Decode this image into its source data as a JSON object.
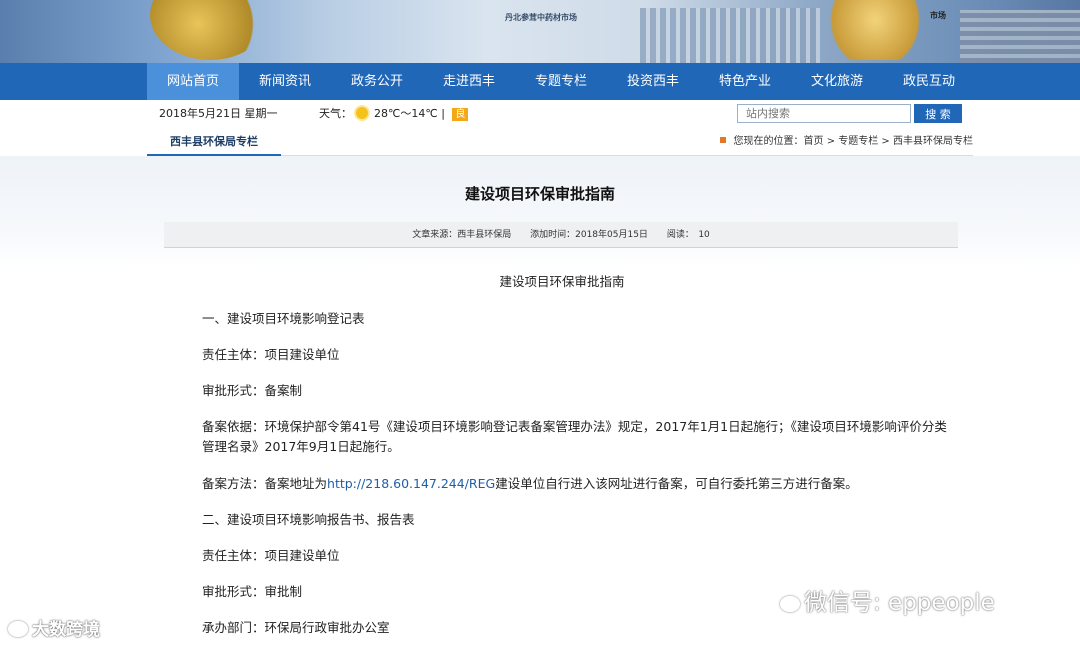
{
  "nav": [
    "网站首页",
    "新闻资讯",
    "政务公开",
    "走进西丰",
    "专题专栏",
    "投资西丰",
    "特色产业",
    "文化旅游",
    "政民互动"
  ],
  "banner": {
    "sign_left": "丹北参茸中药材市场",
    "sign_right": "市场"
  },
  "info": {
    "date": "2018年5月21日 星期一",
    "weather_label": "天气：",
    "temperature": "28℃～14℃",
    "separator": "|",
    "air_quality": "良",
    "search_placeholder": "站内搜索",
    "search_button": "搜 索"
  },
  "section": {
    "title": "西丰县环保局专栏",
    "location": "您现在的位置：首页 > 专题专栏 > 西丰县环保局专栏"
  },
  "article": {
    "title": "建设项目环保审批指南",
    "source": "文章来源：西丰县环保局",
    "time": "添加时间：2018年05月15日",
    "reads": "阅读：　10",
    "heading": "建设项目环保审批指南",
    "p1": "一、建设项目环境影响登记表",
    "p2": "责任主体：项目建设单位",
    "p3": "审批形式：备案制",
    "p4": "备案依据：环境保护部令第41号《建设项目环境影响登记表备案管理办法》规定，2017年1月1日起施行；《建设项目环境影响评价分类管理名录》2017年9月1日起施行。",
    "p5_before": "备案方法：备案地址为",
    "p5_link": "http://218.60.147.244/REG",
    "p5_after": "建设单位自行进入该网址进行备案，可自行委托第三方进行备案。",
    "p6": "二、建设项目环境影响报告书、报告表",
    "p7": "责任主体：项目建设单位",
    "p8": "审批形式：审批制",
    "p9": "承办部门：环保局行政审批办公室"
  },
  "watermark": {
    "left": "大数跨境",
    "right": "微信号: eppeople"
  }
}
